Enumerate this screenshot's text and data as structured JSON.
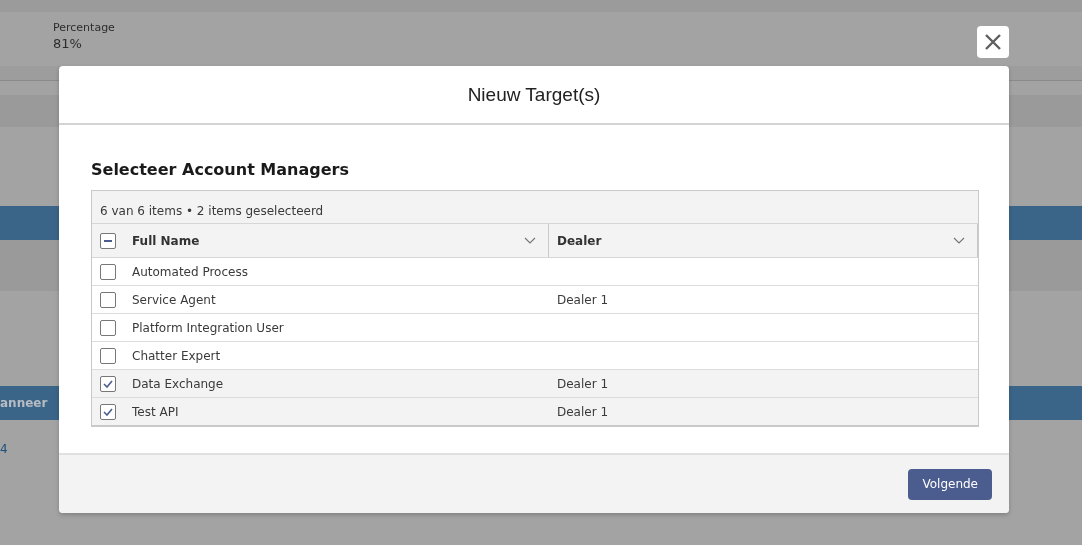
{
  "background": {
    "percentage_label": "Percentage",
    "percentage_value": "81%",
    "banner_fragment": "anneer",
    "link_fragment": "4"
  },
  "modal": {
    "title": "Nieuw Target(s)",
    "section_title": "Selecteer Account Managers",
    "table": {
      "summary": "6 van 6 items • 2 items geselecteerd",
      "select_all": {
        "indeterminate": true
      },
      "columns": [
        {
          "label": "Full Name"
        },
        {
          "label": "Dealer"
        }
      ],
      "rows": [
        {
          "full_name": "Automated Process",
          "selected": false
        },
        {
          "full_name": "Service Agent",
          "dealer": "Dealer 1",
          "selected": false
        },
        {
          "full_name": "Platform Integration User",
          "selected": false
        },
        {
          "full_name": "Chatter Expert",
          "selected": false
        },
        {
          "full_name": "Data Exchange",
          "dealer": "Dealer 1",
          "selected": true
        },
        {
          "full_name": "Test API",
          "dealer": "Dealer 1",
          "selected": true
        }
      ]
    },
    "next_button": "Volgende"
  }
}
